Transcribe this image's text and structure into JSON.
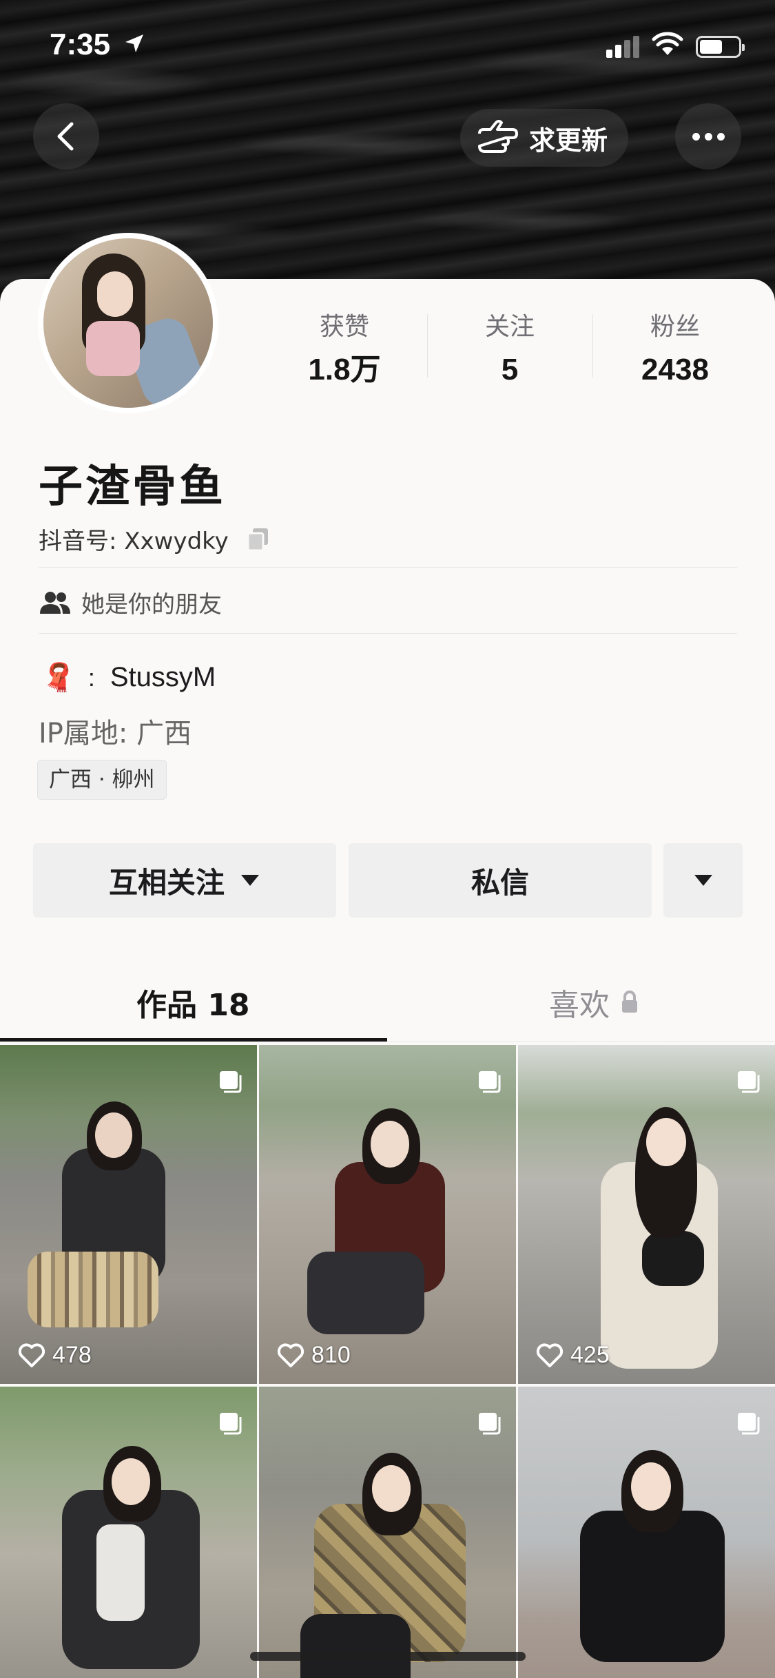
{
  "status_bar": {
    "time": "7:35",
    "battery_level": 0.6
  },
  "header": {
    "update_label": "求更新"
  },
  "profile": {
    "name": "子渣骨鱼",
    "douyin_id": "抖音号: Xxwydky",
    "friend_text": "她是你的朋友",
    "signature_emoji": "🧣",
    "signature_text": "StussyM",
    "ip_location": "IP属地: 广西",
    "location_tag": "广西 · 柳州",
    "stats": [
      {
        "label": "获赞",
        "value": "1.8万"
      },
      {
        "label": "关注",
        "value": "5"
      },
      {
        "label": "粉丝",
        "value": "2438"
      }
    ]
  },
  "actions": {
    "follow_label": "互相关注",
    "message_label": "私信"
  },
  "tabs": {
    "works_label": "作品 18",
    "likes_label": "喜欢"
  },
  "colors": {
    "accent_text": "#161616",
    "button_bg": "#efefef",
    "secondary_text": "#6e6e73"
  },
  "grid": [
    {
      "likes": "478"
    },
    {
      "likes": "810"
    },
    {
      "likes": "425"
    },
    {
      "likes": ""
    },
    {
      "likes": ""
    },
    {
      "likes": ""
    }
  ]
}
